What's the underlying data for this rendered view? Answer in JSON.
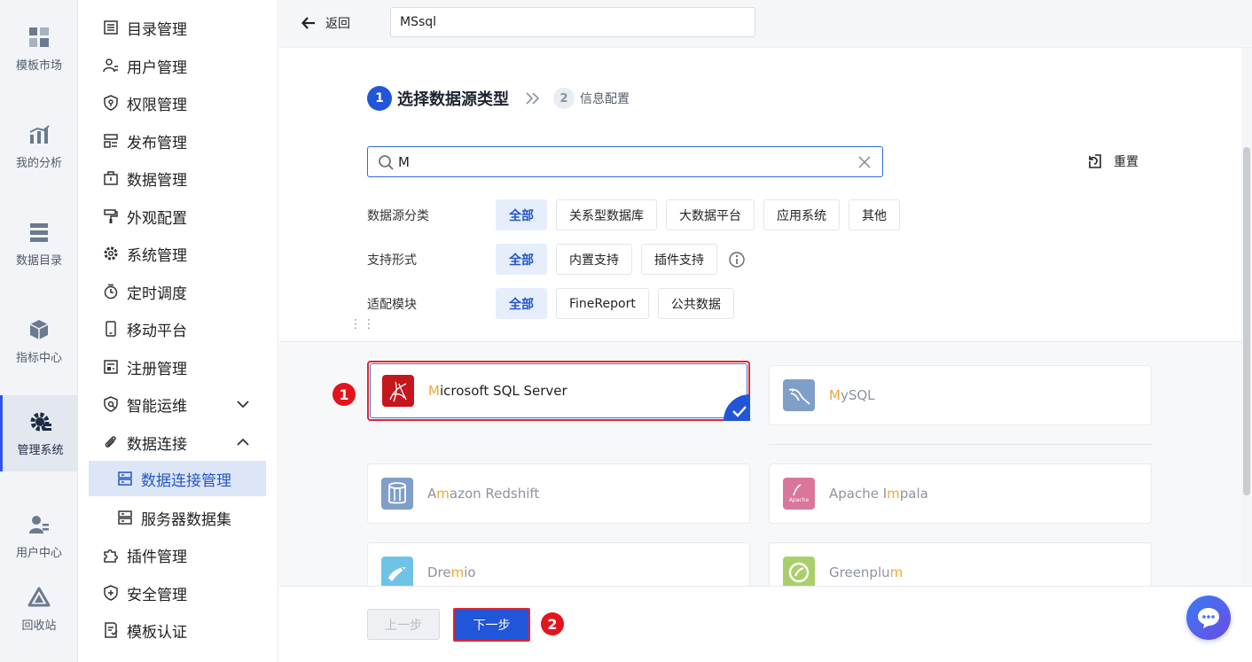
{
  "rail": [
    {
      "label": "模板市场",
      "icon": "template-market-icon"
    },
    {
      "label": "我的分析",
      "icon": "analysis-icon"
    },
    {
      "label": "数据目录",
      "icon": "data-catalog-icon"
    },
    {
      "label": "指标中心",
      "icon": "metric-center-icon"
    },
    {
      "label": "管理系统",
      "icon": "management-gear-icon",
      "active": true
    },
    {
      "label": "用户中心",
      "icon": "user-center-icon"
    },
    {
      "label": "回收站",
      "icon": "recycle-bin-icon"
    }
  ],
  "menu": [
    {
      "label": "目录管理"
    },
    {
      "label": "用户管理"
    },
    {
      "label": "权限管理"
    },
    {
      "label": "发布管理"
    },
    {
      "label": "数据管理"
    },
    {
      "label": "外观配置"
    },
    {
      "label": "系统管理"
    },
    {
      "label": "定时调度"
    },
    {
      "label": "移动平台"
    },
    {
      "label": "注册管理"
    },
    {
      "label": "智能运维"
    },
    {
      "label": "数据连接"
    },
    {
      "label": "数据连接管理"
    },
    {
      "label": "服务器数据集"
    },
    {
      "label": "插件管理"
    },
    {
      "label": "安全管理"
    },
    {
      "label": "模板认证"
    }
  ],
  "header": {
    "back_label": "返回",
    "connection_name": "MSsql"
  },
  "steps": {
    "step1_num": "1",
    "step1_label": "选择数据源类型",
    "step2_num": "2",
    "step2_label": "信息配置"
  },
  "search": {
    "value": "M"
  },
  "reset_label": "重置",
  "filters": {
    "category": {
      "label": "数据源分类",
      "options": [
        "全部",
        "关系型数据库",
        "大数据平台",
        "应用系统",
        "其他"
      ],
      "selected": "全部"
    },
    "support": {
      "label": "支持形式",
      "options": [
        "全部",
        "内置支持",
        "插件支持"
      ],
      "selected": "全部"
    },
    "module": {
      "label": "适配模块",
      "options": [
        "全部",
        "FineReport",
        "公共数据"
      ],
      "selected": "全部"
    }
  },
  "datasources": [
    {
      "pre": "",
      "hl": "M",
      "post": "icrosoft SQL Server",
      "selected": true,
      "color": "#c5161d",
      "icon": "sqlserver-logo-icon"
    },
    {
      "pre": "",
      "hl": "M",
      "post": "ySQL",
      "selected": false,
      "color": "#7f9fc9",
      "icon": "mysql-logo-icon"
    },
    {
      "pre": "A",
      "hl": "m",
      "post": "azon Redshift",
      "selected": false,
      "color": "#7f9fc9",
      "icon": "redshift-logo-icon"
    },
    {
      "pre": "Apache I",
      "hl": "m",
      "post": "pala",
      "selected": false,
      "color": "#d9779b",
      "icon": "impala-logo-icon"
    },
    {
      "pre": "Dre",
      "hl": "m",
      "post": "io",
      "selected": false,
      "color": "#6fc3e8",
      "icon": "dremio-logo-icon"
    },
    {
      "pre": "Greenplu",
      "hl": "m",
      "post": "",
      "selected": false,
      "color": "#a9cf6a",
      "icon": "greenplum-logo-icon"
    }
  ],
  "markers": [
    "1",
    "2"
  ],
  "footer": {
    "prev_label": "上一步",
    "next_label": "下一步"
  },
  "colors": {
    "accent": "#2256d8",
    "highlight": "#f0a637",
    "marker": "#e3141b"
  }
}
